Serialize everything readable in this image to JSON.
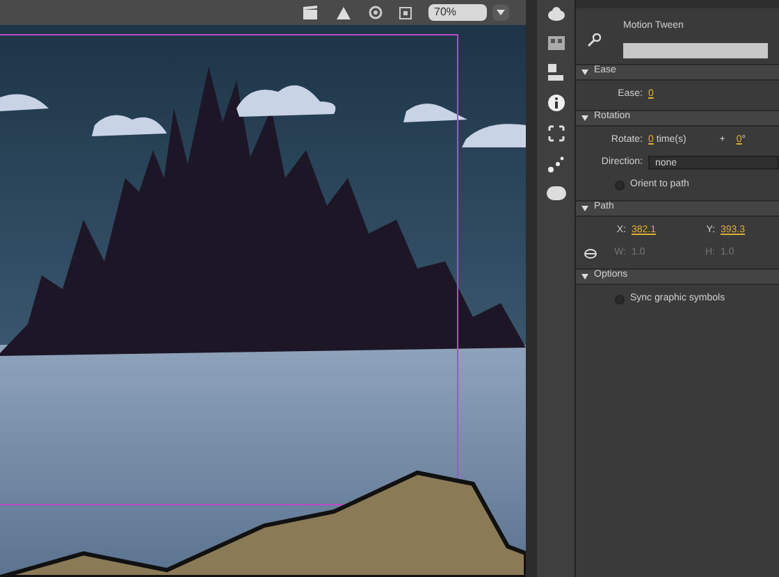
{
  "toolbar": {
    "zoom": "70%"
  },
  "properties": {
    "tween_label": "Motion Tween",
    "sections": [
      {
        "title": "Ease",
        "expanded": true,
        "rows": [
          {
            "kind": "value",
            "label": "Ease:",
            "value": "0"
          }
        ]
      },
      {
        "title": "Rotation",
        "expanded": true,
        "rows": [
          {
            "kind": "rotate",
            "label": "Rotate:",
            "value": "0",
            "unit": "time(s)",
            "joiner": "+",
            "value2": "0",
            "unit2": "°"
          },
          {
            "kind": "select",
            "label": "Direction:",
            "value": "none"
          },
          {
            "kind": "checkbox",
            "label": "Orient to path",
            "checked": false
          }
        ]
      },
      {
        "title": "Path",
        "expanded": true,
        "rows": [
          {
            "kind": "pair",
            "a_label": "X:",
            "a": "382.1",
            "b_label": "Y:",
            "b": "393.3",
            "disabled": false
          },
          {
            "kind": "pair",
            "a_label": "W:",
            "a": "1.0",
            "b_label": "H:",
            "b": "1.0",
            "disabled": true,
            "linked": true
          }
        ]
      },
      {
        "title": "Options",
        "expanded": true,
        "rows": [
          {
            "kind": "checkbox",
            "label": "Sync graphic symbols",
            "checked": false
          }
        ]
      }
    ]
  }
}
